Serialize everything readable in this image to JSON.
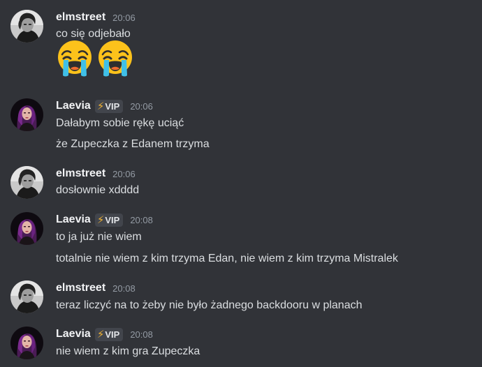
{
  "messages": [
    {
      "user": "elmstreet",
      "time": "20:06",
      "lines": [
        "co się odjebało"
      ],
      "emojis": [
        "loudly-crying-face",
        "loudly-crying-face"
      ]
    },
    {
      "user": "Laevia",
      "badge": {
        "icon": "lightning-bolt",
        "label": "VIP"
      },
      "time": "20:06",
      "lines": [
        "Dałabym sobie rękę uciąć",
        "że Zupeczka z Edanem trzyma"
      ]
    },
    {
      "user": "elmstreet",
      "time": "20:06",
      "lines": [
        "dosłownie xdddd"
      ]
    },
    {
      "user": "Laevia",
      "badge": {
        "icon": "lightning-bolt",
        "label": "VIP"
      },
      "time": "20:08",
      "lines": [
        "to ja już nie wiem",
        "totalnie nie wiem z kim trzyma Edan, nie wiem z kim trzyma Mistralek"
      ]
    },
    {
      "user": "elmstreet",
      "time": "20:08",
      "lines": [
        "teraz liczyć na to żeby nie było żadnego backdooru w planach"
      ]
    },
    {
      "user": "Laevia",
      "badge": {
        "icon": "lightning-bolt",
        "label": "VIP"
      },
      "time": "20:08",
      "lines": [
        "nie wiem z kim gra Zupeczka"
      ]
    }
  ],
  "colors": {
    "background": "#313338",
    "username": "#f2f3f5",
    "text": "#dbdee1",
    "timestamp": "#949ba4",
    "badge_bg": "#42454c",
    "bolt": "#f0b232"
  }
}
